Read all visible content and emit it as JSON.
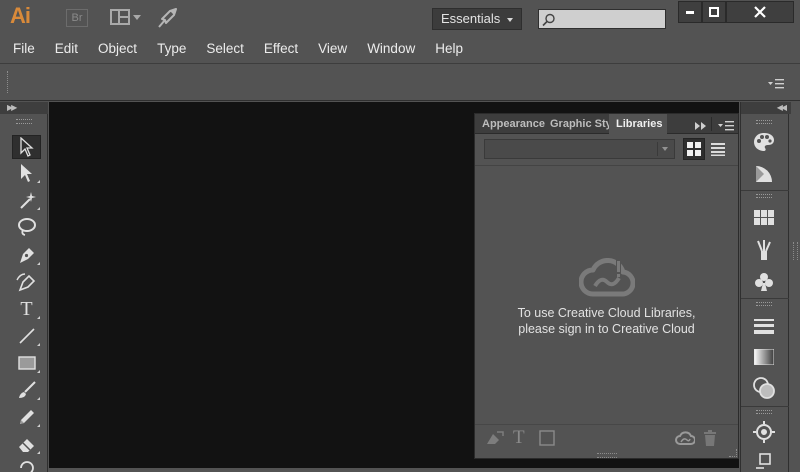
{
  "app": {
    "logo_text": "Ai",
    "bridge_label": "Br",
    "workspace": "Essentials",
    "search": {
      "value": "",
      "placeholder": ""
    }
  },
  "menubar": {
    "items": [
      "File",
      "Edit",
      "Object",
      "Type",
      "Select",
      "Effect",
      "View",
      "Window",
      "Help"
    ]
  },
  "tools": [
    {
      "name": "selection-tool",
      "icon": "selection-arrow-icon",
      "selected": true
    },
    {
      "name": "direct-selection-tool",
      "icon": "direct-selection-arrow-icon"
    },
    {
      "name": "magic-wand-tool",
      "icon": "magic-wand-icon"
    },
    {
      "name": "lasso-tool",
      "icon": "lasso-icon"
    },
    {
      "name": "pen-tool",
      "icon": "pen-icon"
    },
    {
      "name": "curvature-tool",
      "icon": "curvature-pen-icon"
    },
    {
      "name": "type-tool",
      "icon": "type-icon",
      "glyph": "T"
    },
    {
      "name": "line-segment-tool",
      "icon": "line-icon"
    },
    {
      "name": "rectangle-tool",
      "icon": "rectangle-icon"
    },
    {
      "name": "paintbrush-tool",
      "icon": "paintbrush-icon"
    },
    {
      "name": "pencil-tool",
      "icon": "pencil-icon"
    },
    {
      "name": "eraser-tool",
      "icon": "eraser-icon"
    },
    {
      "name": "rotate-tool",
      "icon": "rotate-icon"
    }
  ],
  "panel": {
    "tabs": [
      "Appearance",
      "Graphic Sty",
      "Libraries"
    ],
    "active_tab": "Libraries",
    "library_select": {
      "value": ""
    },
    "message_line1": "To use Creative Cloud Libraries,",
    "message_line2": "please sign in to Creative Cloud",
    "footer_type_glyph": "T"
  },
  "dock": {
    "icons": [
      "color-palette-icon",
      "color-guide-icon",
      "swatches-icon",
      "brushes-icon",
      "symbols-icon",
      "stroke-icon",
      "gradient-icon",
      "transparency-icon",
      "appearance-icon",
      "align-icon"
    ]
  },
  "colors": {
    "chrome": "#535353",
    "canvas": "#121212",
    "logo": "#d98a3a"
  }
}
